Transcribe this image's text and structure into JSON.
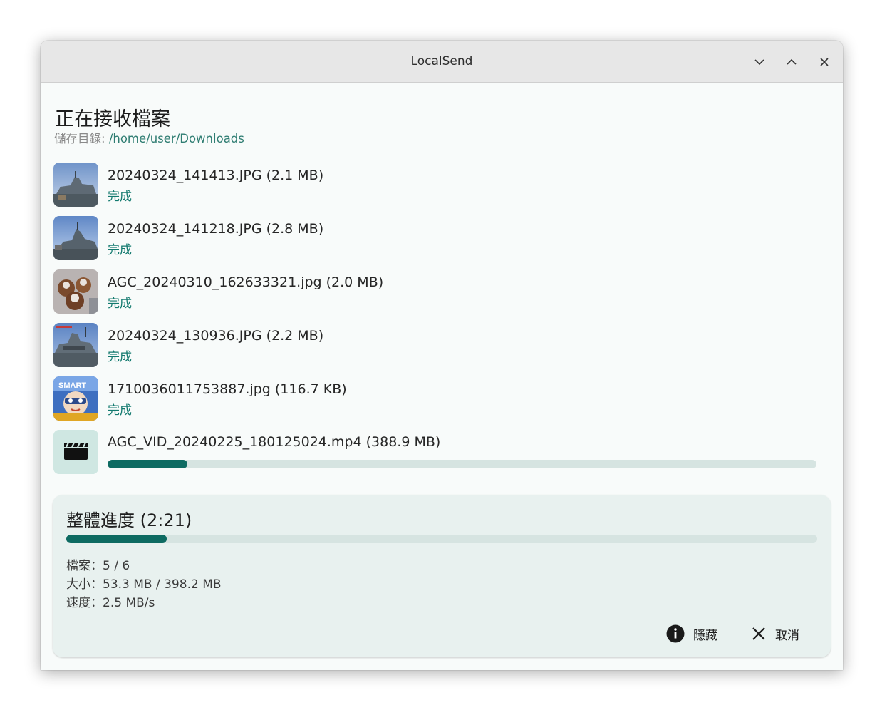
{
  "window": {
    "title": "LocalSend"
  },
  "header": {
    "title": "正在接收檔案",
    "save_label": "儲存目錄: ",
    "save_path": "/home/user/Downloads"
  },
  "files": [
    {
      "name": "20240324_141413.JPG (2.1 MB)",
      "status": "完成",
      "thumb": "warship-photo"
    },
    {
      "name": "20240324_141218.JPG (2.8 MB)",
      "status": "完成",
      "thumb": "warship-photo"
    },
    {
      "name": "AGC_20240310_162633321.jpg (2.0 MB)",
      "status": "完成",
      "thumb": "pastries-photo"
    },
    {
      "name": "20240324_130936.JPG (2.2 MB)",
      "status": "完成",
      "thumb": "warship-photo"
    },
    {
      "name": "1710036011753887.jpg (116.7 KB)",
      "status": "完成",
      "thumb": "cartoon-photo"
    },
    {
      "name": "AGC_VID_20240225_180125024.mp4 (388.9 MB)",
      "status": "",
      "thumb": "video-clapper-icon",
      "progress": 0.113
    }
  ],
  "overall": {
    "title": "整體進度 (2:21)",
    "progress": 0.134,
    "files_stat": "檔案：5 / 6",
    "size_stat": "大小：53.3 MB / 398.2 MB",
    "speed_stat": "速度：2.5 MB/s"
  },
  "actions": {
    "hide_label": "隱藏",
    "cancel_label": "取消"
  },
  "colors": {
    "accent": "#0e6b62",
    "track": "#d6e4e1",
    "status": "#137a6f",
    "panel": "#e8f1ef"
  }
}
